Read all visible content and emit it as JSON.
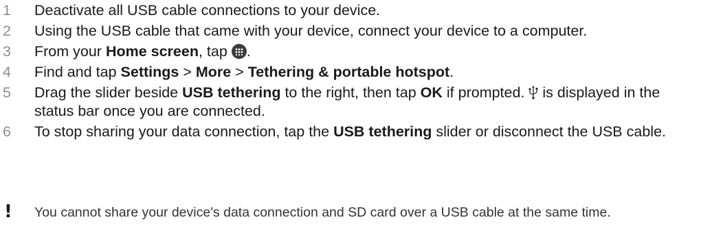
{
  "steps": [
    {
      "num": "1",
      "text": "Deactivate all USB cable connections to your device."
    },
    {
      "num": "2",
      "text": "Using the USB cable that came with your device, connect your device to a computer."
    },
    {
      "num": "3",
      "pre": "From your ",
      "bold": "Home screen",
      "post": ", tap ",
      "end": "."
    },
    {
      "num": "4",
      "pre": "Find and tap ",
      "b1": "Settings",
      "s1": " > ",
      "b2": "More",
      "s2": " > ",
      "b3": "Tethering & portable hotspot",
      "end": "."
    },
    {
      "num": "5",
      "pre": "Drag the slider beside ",
      "b1": "USB tethering",
      "mid": " to the right, then tap ",
      "b2": "OK",
      "post": " if prompted. ",
      "after": " is displayed in the status bar once you are connected."
    },
    {
      "num": "6",
      "pre": "To stop sharing your data connection, tap the ",
      "b1": "USB tethering",
      "post": " slider or disconnect the USB cable."
    }
  ],
  "icons": {
    "step3": "apps-icon",
    "step5": "usb-icon"
  },
  "note": {
    "mark": "!",
    "text": "You cannot share your device's data connection and SD card over a USB cable at the same time."
  }
}
